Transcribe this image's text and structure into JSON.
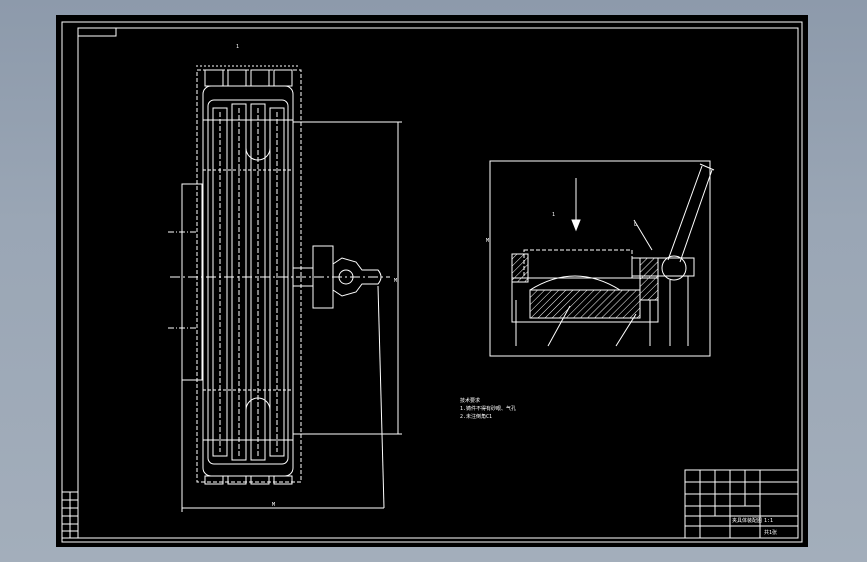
{
  "drawing": {
    "background": "#000000",
    "line_color": "#ffffff",
    "hatch_color": "#ffffff",
    "viewport_frame_color": "#9aa6b5"
  },
  "labels": {
    "top_dimension_mark": "1",
    "bottom_dimension_mark": "M",
    "right_dimension_mark": "M",
    "section_view_mark": "M",
    "section_arrow_label": "1",
    "lever_label": "L"
  },
  "technical_notes": {
    "line1": "技术要求",
    "line2": "1.铸件不得有砂眼、气孔",
    "line3": "2.未注倒角C1"
  },
  "title_block": {
    "drawing_name": "夹具体装配图",
    "scale": "1:1",
    "sheet": "共1张"
  }
}
